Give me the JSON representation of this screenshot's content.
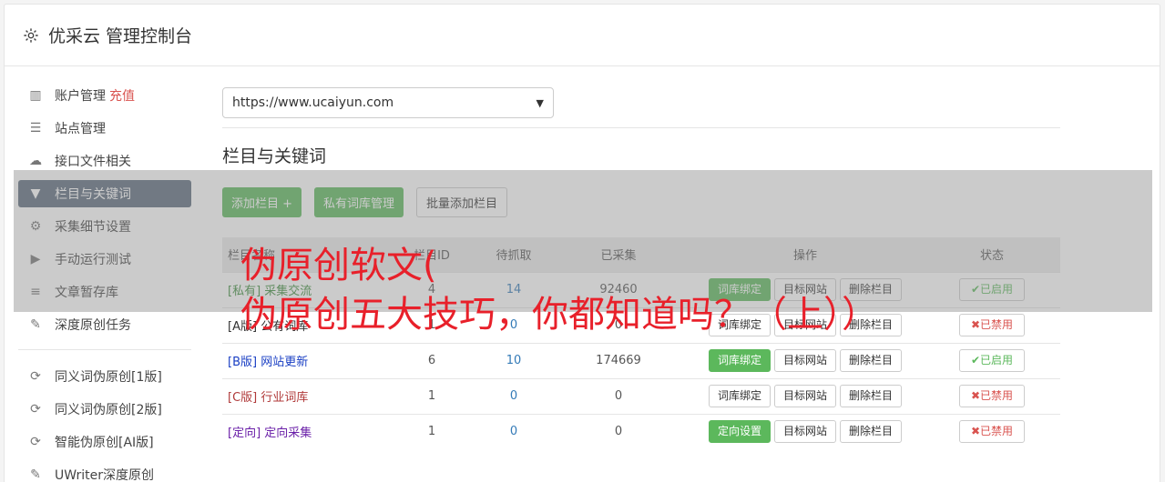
{
  "header": {
    "title": "优采云 管理控制台"
  },
  "sidebar": {
    "items": [
      {
        "icon": "bar-chart-icon",
        "glyph": "▥",
        "label": "账户管理",
        "extra": "充值"
      },
      {
        "icon": "server-icon",
        "glyph": "☰",
        "label": "站点管理"
      },
      {
        "icon": "cloud-upload-icon",
        "glyph": "☁",
        "label": "接口文件相关"
      },
      {
        "icon": "filter-icon",
        "glyph": "▼",
        "label": "栏目与关键词",
        "active": true
      },
      {
        "icon": "gears-icon",
        "glyph": "⚙",
        "label": "采集细节设置"
      },
      {
        "icon": "play-circle-icon",
        "glyph": "▶",
        "label": "手动运行测试"
      },
      {
        "icon": "database-icon",
        "glyph": "≡",
        "label": "文章暂存库"
      },
      {
        "icon": "edit-icon",
        "glyph": "✎",
        "label": "深度原创任务"
      }
    ],
    "tools": [
      {
        "icon": "refresh-icon",
        "glyph": "⟳",
        "label": "同义词伪原创[1版]"
      },
      {
        "icon": "refresh-icon",
        "glyph": "⟳",
        "label": "同义词伪原创[2版]"
      },
      {
        "icon": "refresh-icon",
        "glyph": "⟳",
        "label": "智能伪原创[AI版]"
      },
      {
        "icon": "edit-icon",
        "glyph": "✎",
        "label": "UWriter深度原创"
      }
    ]
  },
  "main": {
    "site_select": "https://www.ucaiyun.com",
    "section_title": "栏目与关键词",
    "buttons": {
      "add": "添加栏目 +",
      "private": "私有词库管理",
      "batch": "批量添加栏目"
    },
    "table": {
      "headers": [
        "栏目名称",
        "栏目ID",
        "待抓取",
        "已采集",
        "操作",
        "状态"
      ],
      "rows": [
        {
          "tag": "[私有]",
          "name": "采集交流",
          "color": "#3c8d3c",
          "id": "4",
          "pending": "14",
          "collected": "92460",
          "op1": "词库绑定",
          "op1_green": true,
          "op2": "目标网站",
          "op3": "删除栏目",
          "status": "已启用",
          "enabled": true
        },
        {
          "tag": "[A版]",
          "name": "公有词库",
          "color": "#333333",
          "id": "1",
          "pending": "0",
          "collected": "0",
          "op1": "词库绑定",
          "op1_green": false,
          "op2": "目标网站",
          "op3": "删除栏目",
          "status": "已禁用",
          "enabled": false
        },
        {
          "tag": "[B版]",
          "name": "网站更新",
          "color": "#1a3fc4",
          "id": "6",
          "pending": "10",
          "collected": "174669",
          "op1": "词库绑定",
          "op1_green": true,
          "op2": "目标网站",
          "op3": "删除栏目",
          "status": "已启用",
          "enabled": true
        },
        {
          "tag": "[C版]",
          "name": "行业词库",
          "color": "#b03a3a",
          "id": "1",
          "pending": "0",
          "collected": "0",
          "op1": "词库绑定",
          "op1_green": false,
          "op2": "目标网站",
          "op3": "删除栏目",
          "status": "已禁用",
          "enabled": false
        },
        {
          "tag": "[定向]",
          "name": "定向采集",
          "color": "#6a1fa8",
          "id": "1",
          "pending": "0",
          "collected": "0",
          "op1": "定向设置",
          "op1_green": true,
          "op2": "目标网站",
          "op3": "删除栏目",
          "status": "已禁用",
          "enabled": false
        }
      ]
    }
  },
  "overlay": {
    "line1": "伪原创软文(",
    "line2": "伪原创五大技巧，你都知道吗？（上））"
  }
}
